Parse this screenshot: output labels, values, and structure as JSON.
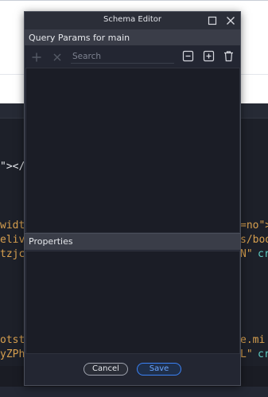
{
  "dialog": {
    "title": "Schema Editor",
    "query_params_header": "Query Params for main",
    "search_placeholder": "Search",
    "properties_header": "Properties",
    "cancel_label": "Cancel",
    "save_label": "Save"
  },
  "icons": {
    "maximize": "maximize-icon",
    "close": "close-icon",
    "add": "plus-icon",
    "remove": "x-icon",
    "collapse_all": "minus-square-icon",
    "expand_all": "plus-square-icon",
    "delete": "trash-icon"
  },
  "background_code": {
    "line1": "\"></",
    "line2_a": "widt",
    "line2_b": "=no\">",
    "line3_a": "eliv",
    "line3_b": "s/boo",
    "line4_a": "tzjc",
    "line4_b": "N\"",
    "line4_c": "cr",
    "line5_a": "otst",
    "line5_b": "e.mi",
    "line6_a": "yZPh",
    "line6_b": "L\"",
    "line6_c": "cr"
  },
  "colors": {
    "accent": "#3b82f6",
    "dialog_bg": "#232632",
    "panel_bg": "#1b1d26",
    "header_bg": "#3a3d48",
    "code_string": "#d8a04f",
    "code_attr": "#5cc9c0"
  }
}
